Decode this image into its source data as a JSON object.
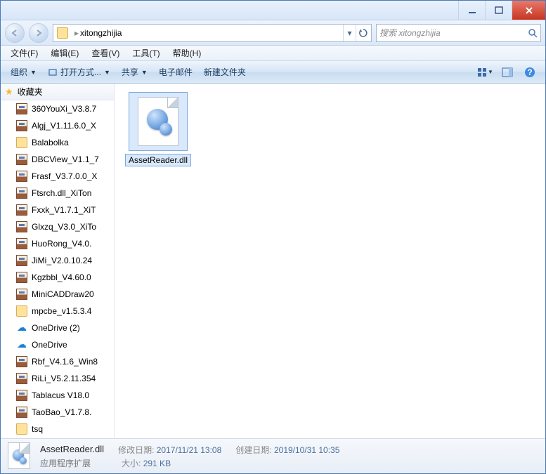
{
  "address": {
    "path": "xitongzhijia",
    "search_placeholder": "搜索 xitongzhijia"
  },
  "menu": {
    "file": "文件(F)",
    "edit": "编辑(E)",
    "view": "查看(V)",
    "tools": "工具(T)",
    "help": "帮助(H)"
  },
  "toolbar": {
    "organize": "组织",
    "openwith": "打开方式...",
    "share": "共享",
    "email": "电子邮件",
    "newfolder": "新建文件夹"
  },
  "sidebar": {
    "favorites": "收藏夹",
    "items": [
      {
        "icon": "rar",
        "label": "360YouXi_V3.8.7"
      },
      {
        "icon": "rar",
        "label": "Algj_V1.11.6.0_X"
      },
      {
        "icon": "folder",
        "label": "Balabolka"
      },
      {
        "icon": "rar",
        "label": "DBCView_V1.1_7"
      },
      {
        "icon": "rar",
        "label": "Frasf_V3.7.0.0_X"
      },
      {
        "icon": "rar",
        "label": "Ftsrch.dll_XiTon"
      },
      {
        "icon": "rar",
        "label": "Fxxk_V1.7.1_XiT"
      },
      {
        "icon": "rar",
        "label": "Glxzq_V3.0_XiTo"
      },
      {
        "icon": "rar",
        "label": "HuoRong_V4.0."
      },
      {
        "icon": "rar",
        "label": "JiMi_V2.0.10.24"
      },
      {
        "icon": "rar",
        "label": "Kgzbbl_V4.60.0"
      },
      {
        "icon": "rar",
        "label": "MiniCADDraw20"
      },
      {
        "icon": "folder",
        "label": "mpcbe_v1.5.3.4"
      },
      {
        "icon": "cloud",
        "label": "OneDrive (2)"
      },
      {
        "icon": "cloud",
        "label": "OneDrive"
      },
      {
        "icon": "rar",
        "label": "Rbf_V4.1.6_Win8"
      },
      {
        "icon": "rar",
        "label": "RiLi_V5.2.11.354"
      },
      {
        "icon": "rar",
        "label": "Tablacus V18.0"
      },
      {
        "icon": "rar",
        "label": "TaoBao_V1.7.8."
      },
      {
        "icon": "folder",
        "label": "tsq"
      }
    ]
  },
  "file": {
    "name": "AssetReader.dll"
  },
  "details": {
    "name": "AssetReader.dll",
    "type": "应用程序扩展",
    "mod_label": "修改日期:",
    "mod_value": "2017/11/21 13:08",
    "size_label": "大小:",
    "size_value": "291 KB",
    "created_label": "创建日期:",
    "created_value": "2019/10/31 10:35"
  }
}
